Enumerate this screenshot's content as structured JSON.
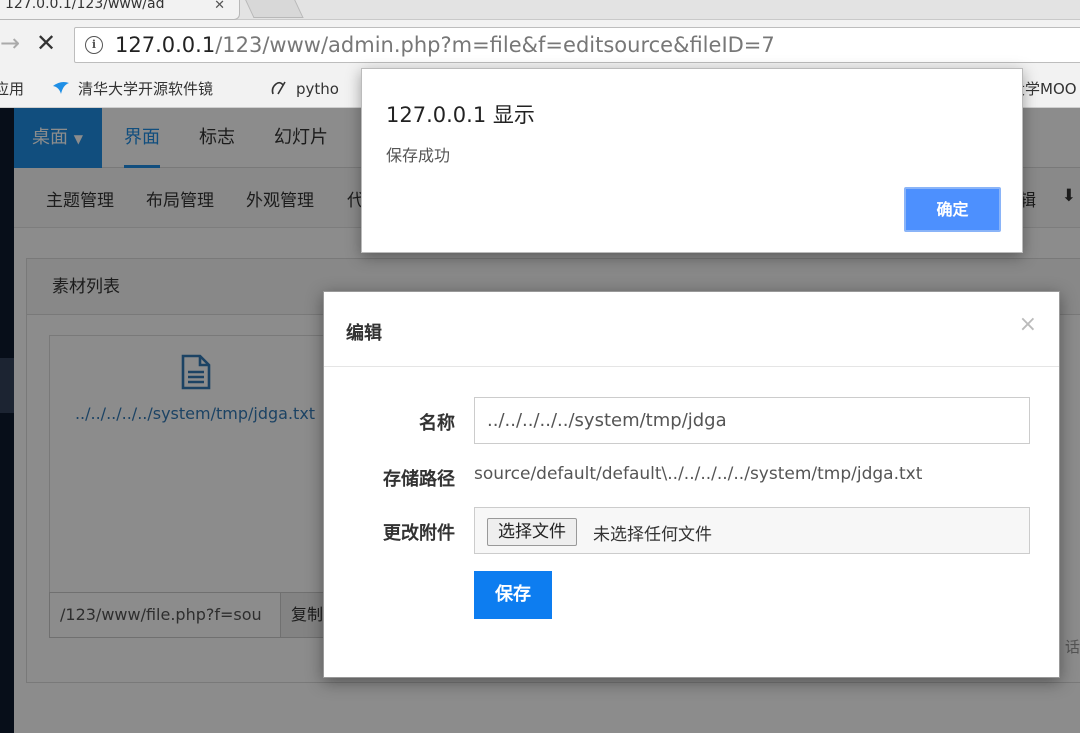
{
  "browser": {
    "tab_title": "127.0.0.1/123/www/ad",
    "url_host": "127.0.0.1",
    "url_path": "/123/www/admin.php?m=file&f=editsource&fileID=7",
    "bookmarks": [
      "应用",
      "清华大学开源软件镜",
      "pytho",
      "大学MOO"
    ]
  },
  "page": {
    "topnav": {
      "desk": "桌面",
      "items": [
        "界面",
        "标志",
        "幻灯片"
      ]
    },
    "subnav": {
      "items": [
        "主题管理",
        "布局管理",
        "外观管理",
        "代"
      ],
      "right_text": "辑"
    },
    "panel_title": "素材列表",
    "file_card": {
      "name": "../../../../../system/tmp/jdga.txt",
      "link": "/123/www/file.php?f=sou",
      "copy_label": "复制"
    },
    "right_bg_text": "话"
  },
  "modal": {
    "title": "编辑",
    "close": "×",
    "labels": {
      "name": "名称",
      "path": "存储路径",
      "attachment": "更改附件"
    },
    "name_value": "../../../../../system/tmp/jdga",
    "path_value": "source/default/default\\../../../../../system/tmp/jdga.txt",
    "choose_file": "选择文件",
    "no_file": "未选择任何文件",
    "save": "保存"
  },
  "alert": {
    "title": "127.0.0.1 显示",
    "message": "保存成功",
    "ok": "确定"
  },
  "colors": {
    "primary": "#1f8fe6",
    "save_button": "#0d7df0",
    "alert_button": "#4d90fe"
  }
}
